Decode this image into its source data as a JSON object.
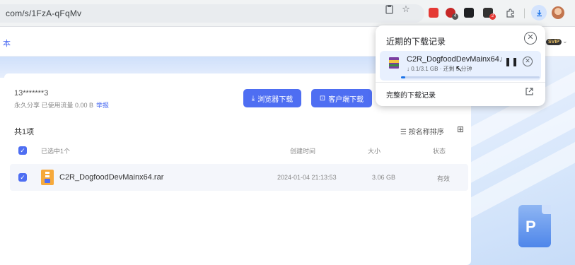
{
  "browser": {
    "url": "com/s/1FzA-qFqMv",
    "icons": [
      "screenshot-icon",
      "bookmark-star-icon",
      "extension-icon",
      "extension-badge-icon",
      "tablet-icon",
      "extension-red-icon",
      "puzzle-icon",
      "download-icon",
      "profile-avatar"
    ],
    "badges": {
      "ext2": "4",
      "ext4": "2"
    }
  },
  "header": {
    "left_text": "本",
    "vip": "SVIP"
  },
  "share": {
    "account": "13*******3",
    "info": "永久分享  已使用流量  0.00 B",
    "report": "举报",
    "browser_download": "浏览器下载",
    "client_download": "客户端下载",
    "total": "共1项",
    "sort": "按名称排序"
  },
  "table": {
    "header": {
      "selected": "已选中1个",
      "created": "创建时间",
      "size": "大小",
      "status": "状态"
    },
    "rows": [
      {
        "name": "C2R_DogfoodDevMainx64.rar",
        "created": "2024-01-04 21:13:53",
        "size": "3.06 GB",
        "status": "有效"
      }
    ]
  },
  "download_popup": {
    "title": "近期的下载记录",
    "file_name": "C2R_DogfoodDevMainx64.r",
    "status": "↓ 0.1/3.1 GB · 还剩 5 分钟",
    "progress": 0.03,
    "full_history": "完整的下载记录"
  },
  "colors": {
    "accent": "#4e6ef2",
    "chrome_blue": "#1a73e8"
  }
}
